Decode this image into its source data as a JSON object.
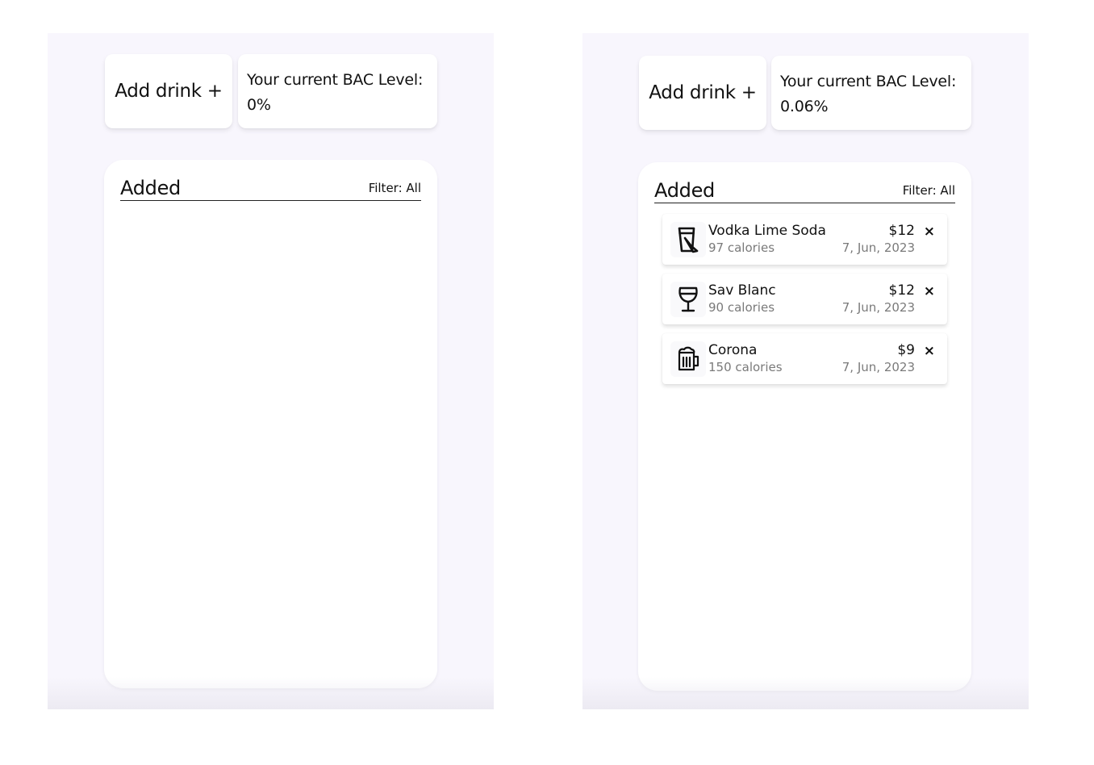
{
  "colors": {
    "page_background": "#ffffff",
    "panel_background": "#f8f6fd",
    "card_background": "#ffffff",
    "secondary_text": "#7a7a7a"
  },
  "screens": [
    {
      "add_drink_label": "Add drink +",
      "bac_label": "Your current BAC Level:",
      "bac_value": "0%",
      "list_title": "Added",
      "filter_label": "Filter: All",
      "drinks": []
    },
    {
      "add_drink_label": "Add drink +",
      "bac_label": "Your current BAC Level:",
      "bac_value": "0.06%",
      "list_title": "Added",
      "filter_label": "Filter: All",
      "drinks": [
        {
          "icon": "cocktail-glass-icon",
          "name": "Vodka Lime Soda",
          "calories": "97 calories",
          "price": "$12",
          "date": "7, Jun, 2023",
          "remove": "×"
        },
        {
          "icon": "wine-glass-icon",
          "name": "Sav Blanc",
          "calories": "90 calories",
          "price": "$12",
          "date": "7, Jun, 2023",
          "remove": "×"
        },
        {
          "icon": "beer-mug-icon",
          "name": "Corona",
          "calories": "150 calories",
          "price": "$9",
          "date": "7, Jun, 2023",
          "remove": "×"
        }
      ]
    }
  ]
}
